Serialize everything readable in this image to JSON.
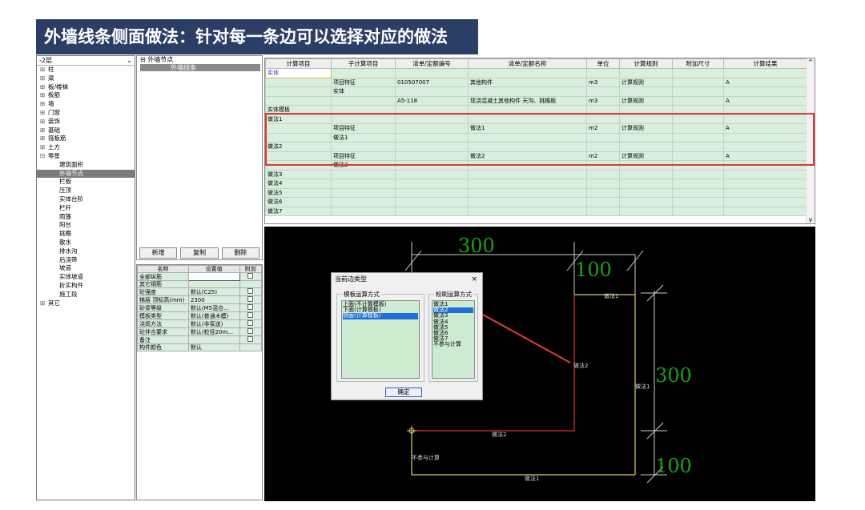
{
  "banner": {
    "title": "外墙线条侧面做法：针对每一条边可以选择对应的做法"
  },
  "tree": {
    "combo": "-2层",
    "items": [
      {
        "label": "柱",
        "pm": "⊞",
        "child": false
      },
      {
        "label": "梁",
        "pm": "⊞",
        "child": false
      },
      {
        "label": "板/楼梯",
        "pm": "⊞",
        "child": false
      },
      {
        "label": "板筋",
        "pm": "⊞",
        "child": false
      },
      {
        "label": "墙",
        "pm": "⊞",
        "child": false
      },
      {
        "label": "门窗",
        "pm": "⊞",
        "child": false
      },
      {
        "label": "装饰",
        "pm": "⊞",
        "child": false
      },
      {
        "label": "基础",
        "pm": "⊞",
        "child": false
      },
      {
        "label": "筏板筋",
        "pm": "⊞",
        "child": false
      },
      {
        "label": "土方",
        "pm": "⊞",
        "child": false
      },
      {
        "label": "零星",
        "pm": "⊟",
        "child": false
      },
      {
        "label": "建筑面积",
        "pm": "",
        "child": true
      },
      {
        "label": "外墙节点",
        "pm": "",
        "child": true,
        "selected": true
      },
      {
        "label": "栏板",
        "pm": "",
        "child": true
      },
      {
        "label": "压顶",
        "pm": "",
        "child": true
      },
      {
        "label": "实体台阶",
        "pm": "",
        "child": true
      },
      {
        "label": "栏杆",
        "pm": "",
        "child": true
      },
      {
        "label": "雨篷",
        "pm": "",
        "child": true
      },
      {
        "label": "阳台",
        "pm": "",
        "child": true
      },
      {
        "label": "挑檐",
        "pm": "",
        "child": true
      },
      {
        "label": "散水",
        "pm": "",
        "child": true
      },
      {
        "label": "排水沟",
        "pm": "",
        "child": true
      },
      {
        "label": "后浇带",
        "pm": "",
        "child": true
      },
      {
        "label": "坡道",
        "pm": "",
        "child": true
      },
      {
        "label": "实体坡道",
        "pm": "",
        "child": true
      },
      {
        "label": "折实构件",
        "pm": "",
        "child": true
      },
      {
        "label": "施工段",
        "pm": "",
        "child": true
      },
      {
        "label": "其它",
        "pm": "⊞",
        "child": false
      }
    ]
  },
  "nodepanel": {
    "header": "外墙节点",
    "selected_row": "外墙线条"
  },
  "buttons": {
    "new": "新增",
    "copy": "复制",
    "delete": "删除"
  },
  "propgrid": {
    "headers": [
      "名称",
      "设置值",
      "附加"
    ],
    "rows": [
      {
        "name": "全部纵筋",
        "value": "",
        "check": true,
        "editing": true
      },
      {
        "name": "其它钢筋",
        "value": "",
        "check": false
      },
      {
        "name": "砼强度",
        "value": "默认(C25)",
        "check": true
      },
      {
        "name": "梯层 顶标高(mm)",
        "value": "2300",
        "check": true
      },
      {
        "name": "砂浆等级",
        "value": "默认(M5混合...",
        "check": true
      },
      {
        "name": "模板类型",
        "value": "默认(普通木模)",
        "check": true
      },
      {
        "name": "浇捣方法",
        "value": "默认(非泵送)",
        "check": true
      },
      {
        "name": "砼拌合要求",
        "value": "默认(粒径20m...",
        "check": true
      },
      {
        "name": "备注",
        "value": "",
        "check": true
      },
      {
        "name": "构件颜色",
        "value": "默认",
        "check": false
      }
    ]
  },
  "calc": {
    "headers": [
      "计算项目",
      "子计算项目",
      "清单/定额编号",
      "清单/定额名称",
      "单位",
      "计算规则",
      "附加尺寸",
      "计算结果"
    ],
    "rows": [
      [
        "实体",
        "",
        "",
        "",
        "",
        "",
        "",
        ""
      ],
      [
        "",
        "项目特征",
        "010507007",
        "其他构件",
        "m3",
        "计算规则",
        "",
        "A"
      ],
      [
        "",
        "实体",
        "",
        "",
        "",
        "",
        "",
        ""
      ],
      [
        "",
        "",
        "A5-118",
        "现浇混凝土其他构件 天沟、挑檐板",
        "m3",
        "计算规则",
        "",
        "A"
      ],
      [
        "实体模板",
        "",
        "",
        "",
        "",
        "",
        "",
        ""
      ],
      [
        "做法1",
        "",
        "",
        "",
        "",
        "",
        "",
        ""
      ],
      [
        "",
        "项目特征",
        "",
        "做法1",
        "m2",
        "计算规则",
        "",
        "A"
      ],
      [
        "",
        "做法1",
        "",
        "",
        "",
        "",
        "",
        ""
      ],
      [
        "做法2",
        "",
        "",
        "",
        "",
        "",
        "",
        ""
      ],
      [
        "",
        "项目特征",
        "",
        "做法2",
        "m2",
        "计算规则",
        "",
        "A"
      ],
      [
        "",
        "做法2",
        "",
        "",
        "",
        "",
        "",
        ""
      ],
      [
        "做法3",
        "",
        "",
        "",
        "",
        "",
        "",
        ""
      ],
      [
        "做法4",
        "",
        "",
        "",
        "",
        "",
        "",
        ""
      ],
      [
        "做法5",
        "",
        "",
        "",
        "",
        "",
        "",
        ""
      ],
      [
        "做法6",
        "",
        "",
        "",
        "",
        "",
        "",
        ""
      ],
      [
        "做法7",
        "",
        "",
        "",
        "",
        "",
        "",
        ""
      ]
    ],
    "scroll_up": "^",
    "scroll_down": "v"
  },
  "cad": {
    "dim_top": "300",
    "dim_top_small": "100",
    "dim_right": "300",
    "dim_right_small": "100",
    "label_top": "做法1",
    "label_left": "做法2",
    "label_right": "做法1",
    "label_mid": "做法2",
    "label_bottom": "做法1",
    "label_none": "不参与计算"
  },
  "dialog": {
    "title": "当前边类型",
    "close": "×",
    "group1": "模板运算方式",
    "group2": "粉刷运算方式",
    "list1": [
      "上面(不计算模板)",
      "下面(计算模板)",
      "侧面(计算模板)"
    ],
    "list1_selected": 2,
    "list2": [
      "做法1",
      "做法2",
      "做法3",
      "做法4",
      "做法5",
      "做法6",
      "做法7",
      "不参与计算"
    ],
    "list2_selected": 1,
    "ok": "确定"
  },
  "colors": {
    "banner_bg": "#2a3e66",
    "grid_green": "#d9eedd",
    "highlight_red": "#e03535",
    "cad_green": "#1aa01a",
    "cad_yellow": "#e0d060"
  }
}
